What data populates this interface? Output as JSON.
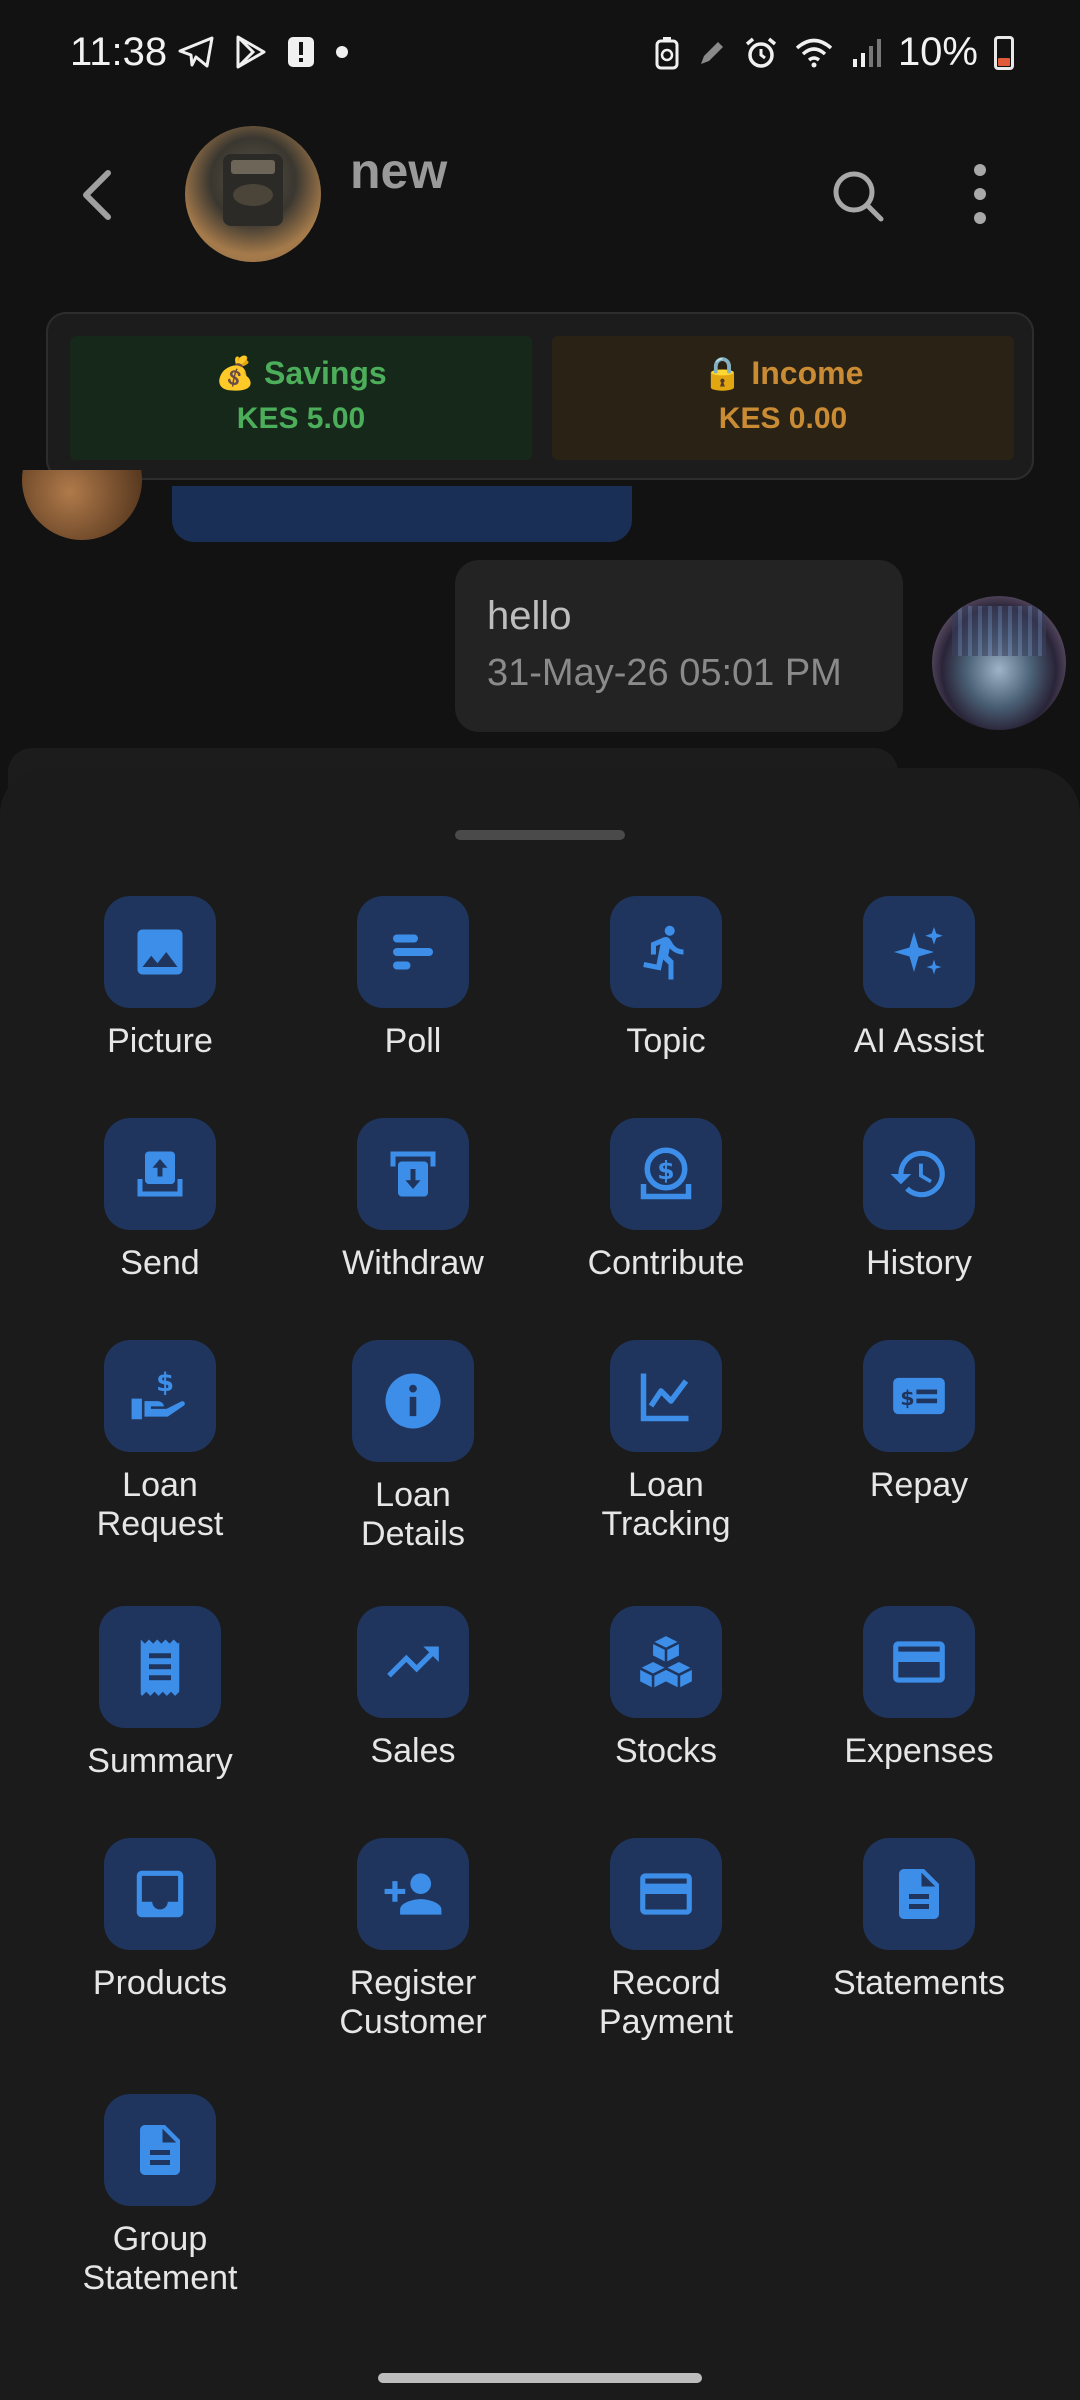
{
  "status_bar": {
    "time": "11:38",
    "battery_percent": "10%",
    "left_icons": [
      "telegram-icon",
      "play-store-icon",
      "alert-icon",
      "dot-icon"
    ],
    "right_icons": [
      "battery-saver-icon",
      "pen-icon",
      "alarm-icon",
      "wifi-icon",
      "signal-icon",
      "battery-icon"
    ]
  },
  "header": {
    "title": "new",
    "back_icon": "back-arrow-icon",
    "search_icon": "search-icon",
    "more_icon": "more-vert-icon"
  },
  "balances": {
    "savings": {
      "label": "💰 Savings",
      "amount": "KES 5.00",
      "color": "#4cae5a"
    },
    "income": {
      "label": "🔒 Income",
      "amount": "KES 0.00",
      "color": "#c98c34"
    }
  },
  "messages": {
    "outgoing": {
      "text": "hello",
      "time": "31-May-26 05:01 PM"
    }
  },
  "sheet": {
    "accent": "#3d8ee8",
    "tile_bg": "#1f355e",
    "items": [
      {
        "label": "Picture",
        "icon": "image-icon"
      },
      {
        "label": "Poll",
        "icon": "poll-icon"
      },
      {
        "label": "Topic",
        "icon": "running-icon"
      },
      {
        "label": "AI Assist",
        "icon": "sparkle-icon"
      },
      {
        "label": "Send",
        "icon": "upload-tray-icon"
      },
      {
        "label": "Withdraw",
        "icon": "download-tray-icon"
      },
      {
        "label": "Contribute",
        "icon": "coin-dollar-icon"
      },
      {
        "label": "History",
        "icon": "history-icon"
      },
      {
        "label": "Loan\nRequest",
        "icon": "hand-dollar-icon"
      },
      {
        "label": "Loan\nDetails",
        "icon": "info-icon"
      },
      {
        "label": "Loan\nTracking",
        "icon": "line-chart-icon"
      },
      {
        "label": "Repay",
        "icon": "money-bill-icon"
      },
      {
        "label": "Summary",
        "icon": "receipt-icon"
      },
      {
        "label": "Sales",
        "icon": "trending-up-icon"
      },
      {
        "label": "Stocks",
        "icon": "boxes-icon"
      },
      {
        "label": "Expenses",
        "icon": "credit-card-icon"
      },
      {
        "label": "Products",
        "icon": "inbox-icon"
      },
      {
        "label": "Register\nCustomer",
        "icon": "add-person-icon"
      },
      {
        "label": "Record\nPayment",
        "icon": "credit-card-icon"
      },
      {
        "label": "Statements",
        "icon": "document-icon"
      },
      {
        "label": "Group\nStatement",
        "icon": "document-icon"
      }
    ]
  }
}
